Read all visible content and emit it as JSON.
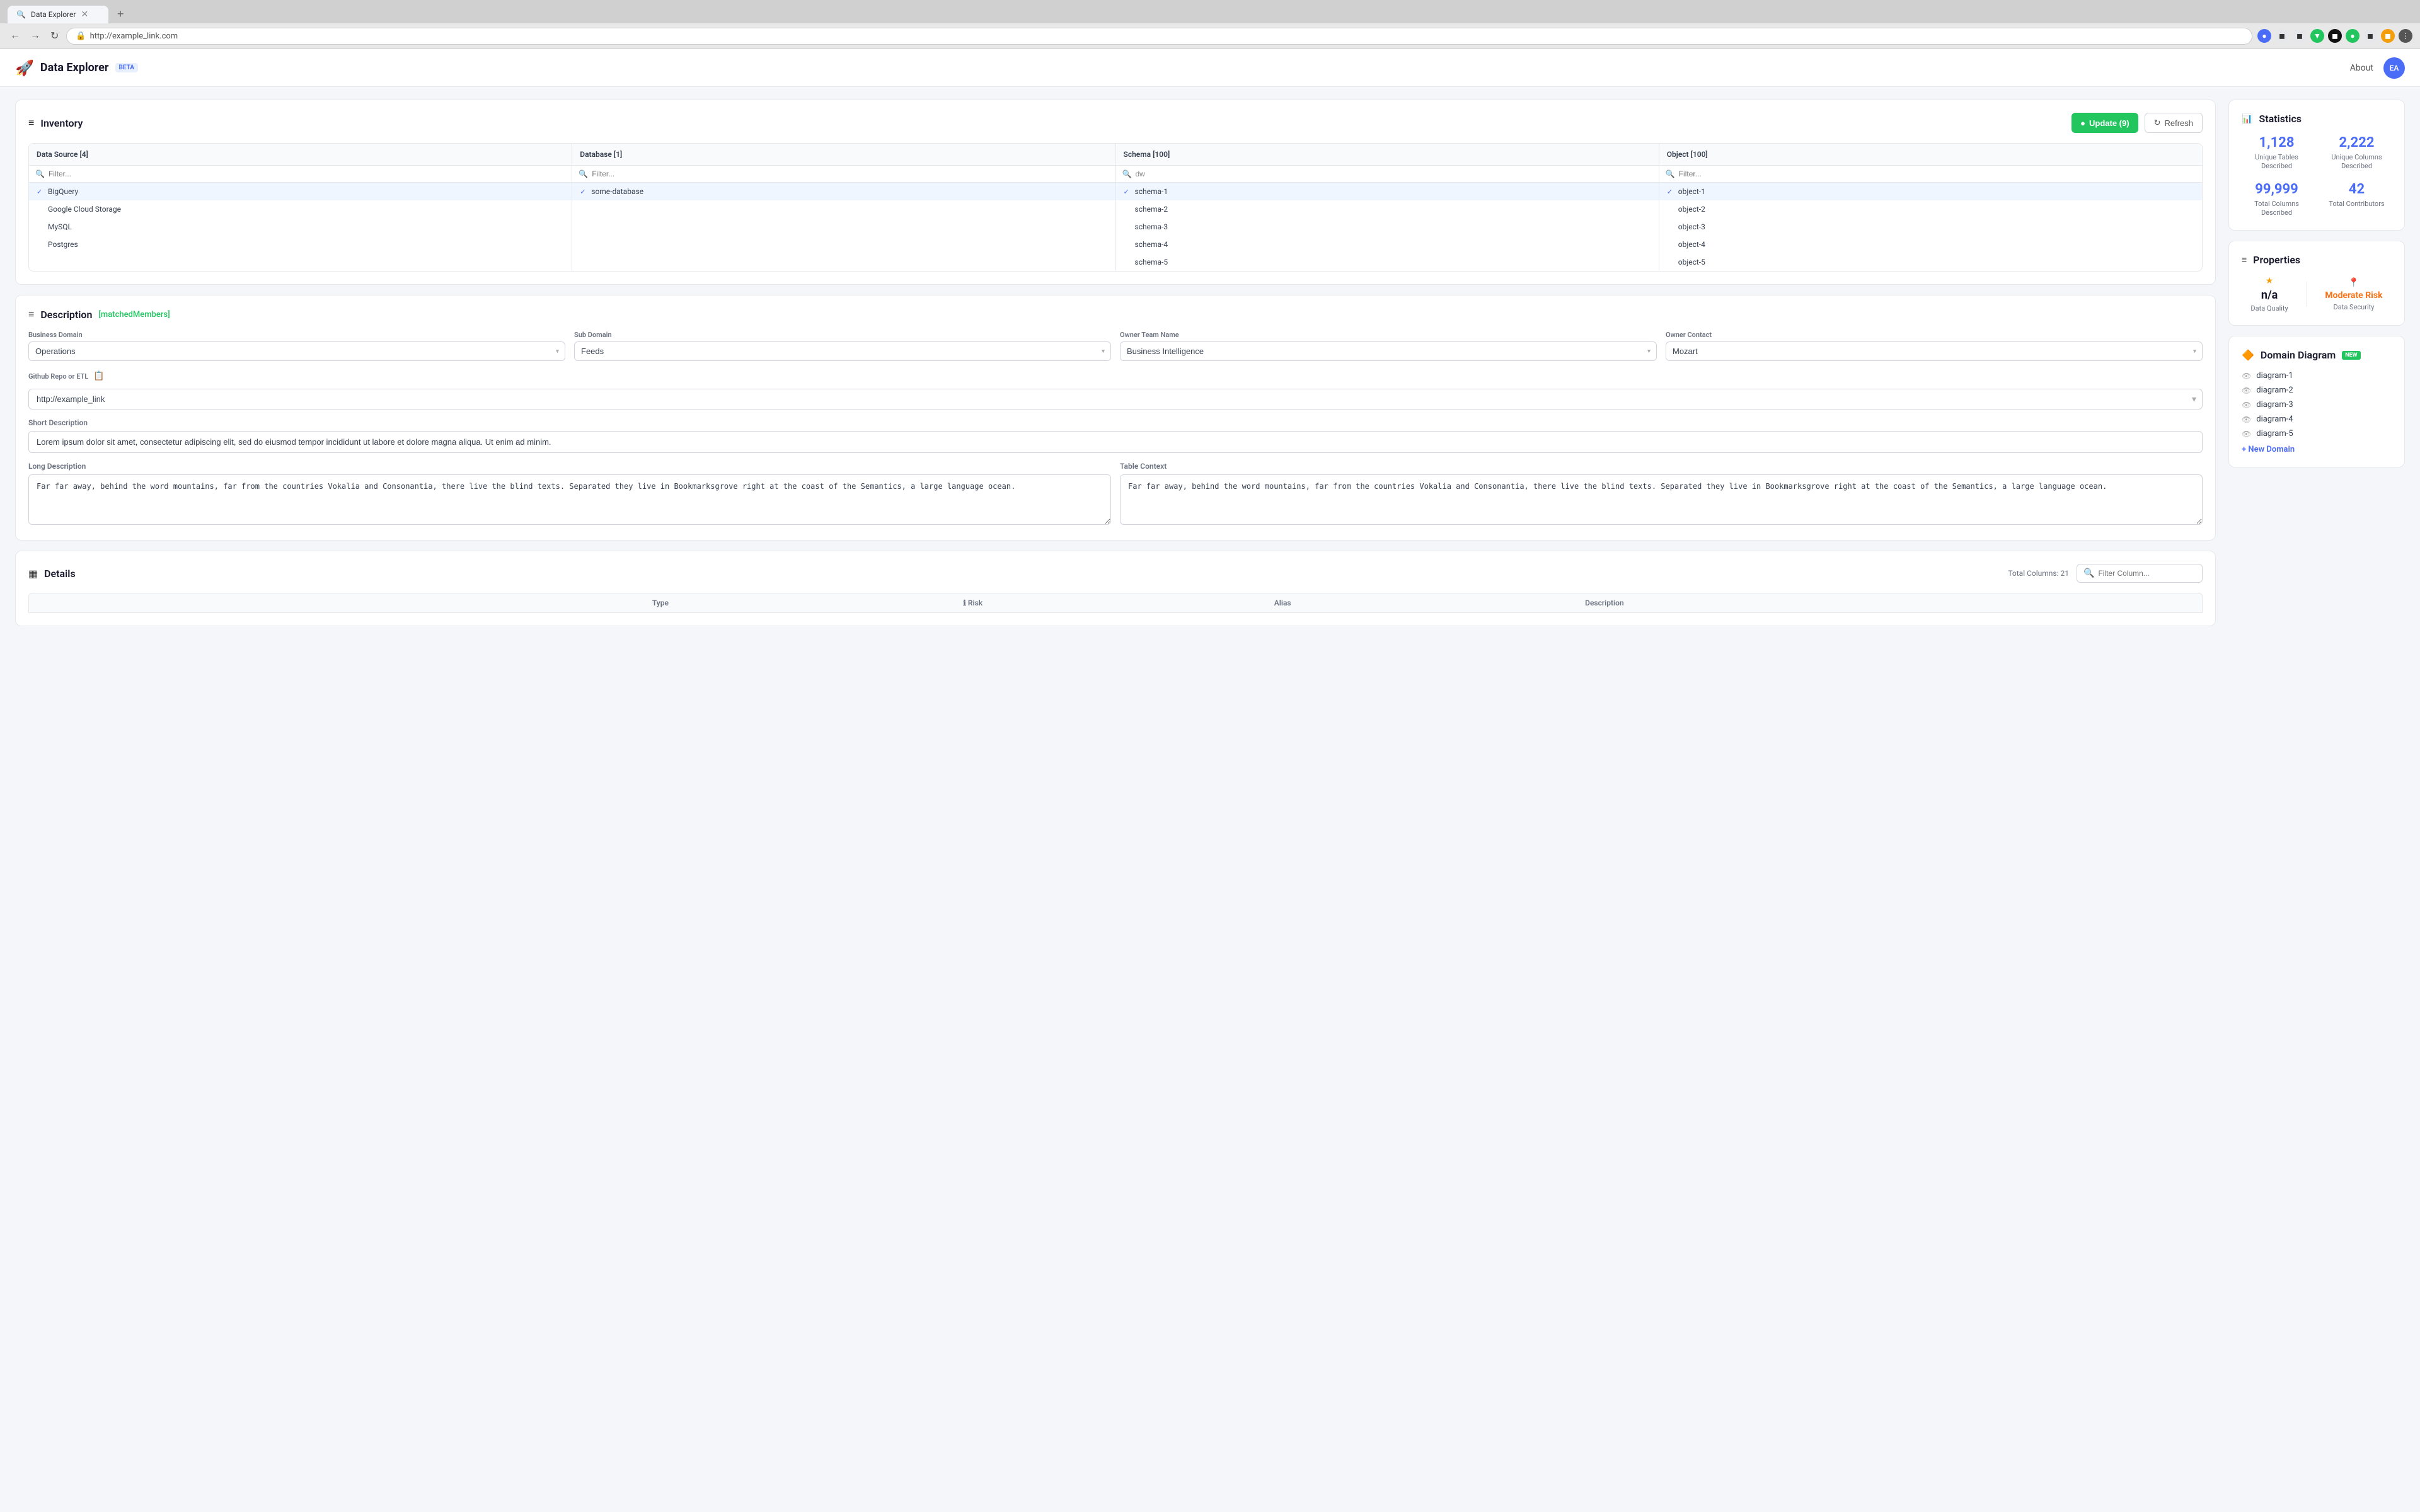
{
  "browser": {
    "tab_title": "Data Explorer",
    "url": "http://example_link.com",
    "new_tab_label": "+"
  },
  "header": {
    "app_title": "Data Explorer",
    "beta_label": "BETA",
    "about_label": "About",
    "avatar_initials": "EA"
  },
  "inventory": {
    "title": "Inventory",
    "update_btn": "Update (9)",
    "refresh_btn": "Refresh",
    "data_source_header": "Data Source [4]",
    "database_header": "Database [1]",
    "schema_header": "Schema [100]",
    "object_header": "Object [100]",
    "filter_placeholder": "Filter...",
    "schema_filter_value": "dw",
    "data_sources": [
      {
        "name": "BigQuery",
        "selected": true
      },
      {
        "name": "Google Cloud Storage",
        "selected": false
      },
      {
        "name": "MySQL",
        "selected": false
      },
      {
        "name": "Postgres",
        "selected": false
      }
    ],
    "databases": [
      {
        "name": "some-database",
        "selected": true
      }
    ],
    "schemas": [
      {
        "name": "schema-1",
        "selected": true
      },
      {
        "name": "schema-2",
        "selected": false
      },
      {
        "name": "schema-3",
        "selected": false
      },
      {
        "name": "schema-4",
        "selected": false
      },
      {
        "name": "schema-5",
        "selected": false
      }
    ],
    "objects": [
      {
        "name": "object-1",
        "selected": true
      },
      {
        "name": "object-2",
        "selected": false
      },
      {
        "name": "object-3",
        "selected": false
      },
      {
        "name": "object-4",
        "selected": false
      },
      {
        "name": "object-5",
        "selected": false
      }
    ]
  },
  "description": {
    "title": "Description",
    "matched_badge": "[matchedMembers]",
    "business_domain_label": "Business Domain",
    "business_domain_value": "Operations",
    "sub_domain_label": "Sub Domain",
    "sub_domain_value": "Feeds",
    "owner_team_label": "Owner Team Name",
    "owner_team_value": "Business Intelligence",
    "owner_contact_label": "Owner Contact",
    "owner_contact_value": "Mozart",
    "github_label": "Github Repo or ETL",
    "github_value": "http://example_link",
    "short_desc_label": "Short Description",
    "short_desc_value": "Lorem ipsum dolor sit amet, consectetur adipiscing elit, sed do eiusmod tempor incididunt ut labore et dolore magna aliqua. Ut enim ad minim.",
    "long_desc_label": "Long Description",
    "long_desc_value": "Far far away, behind the word mountains, far from the countries Vokalia and Consonantia, there live the blind texts. Separated they live in Bookmarksgrove right at the coast of the Semantics, a large language ocean.",
    "table_context_label": "Table Context",
    "table_context_value": "Far far away, behind the word mountains, far from the countries Vokalia and Consonantia, there live the blind texts. Separated they live in Bookmarksgrove right at the coast of the Semantics, a large language ocean."
  },
  "statistics": {
    "title": "Statistics",
    "unique_tables_value": "1,128",
    "unique_tables_label": "Unique Tables Described",
    "unique_columns_value": "2,222",
    "unique_columns_label": "Unique Columns Described",
    "total_columns_value": "99,999",
    "total_columns_label": "Total Columns Described",
    "total_contributors_value": "42",
    "total_contributors_label": "Total Contributors"
  },
  "properties": {
    "title": "Properties",
    "data_quality_value": "n/a",
    "data_quality_label": "Data Quality",
    "data_security_risk": "Moderate Risk",
    "data_security_label": "Data Security"
  },
  "domain_diagram": {
    "title": "Domain Diagram",
    "new_badge": "NEW",
    "diagrams": [
      "diagram-1",
      "diagram-2",
      "diagram-3",
      "diagram-4",
      "diagram-5"
    ],
    "new_domain_label": "+ New Domain"
  },
  "details": {
    "title": "Details",
    "total_columns_label": "Total Columns: 21",
    "filter_placeholder": "Filter Column...",
    "columns": [
      "",
      "Type",
      "Risk",
      "Alias",
      "Description"
    ]
  }
}
